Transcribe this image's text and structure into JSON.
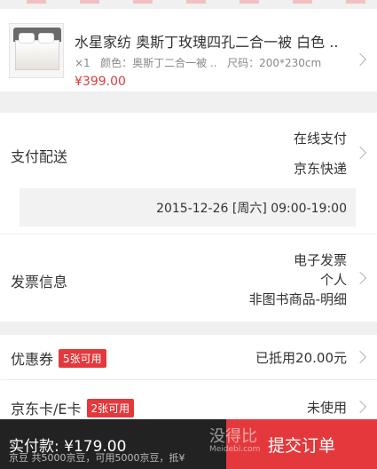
{
  "product": {
    "title": "水星家纺 奥斯丁玫瑰四孔二合一被 白色 ..",
    "qty": "×1",
    "color_label": "颜色：奥斯丁二合一被 ..",
    "size_label": "尺码：200*230cm",
    "price": "¥399.00",
    "image_icon": "product-thumbnail-bedding"
  },
  "payment": {
    "label": "支付配送",
    "method": "在线支付",
    "shipping": "京东快递",
    "delivery_time": "2015-12-26 [周六] 09:00-19:00"
  },
  "invoice": {
    "label": "发票信息",
    "type": "电子发票",
    "title": "个人",
    "content": "非图书商品-明细"
  },
  "coupon": {
    "label": "优惠券",
    "badge": "5张可用",
    "value": "已抵用20.00元"
  },
  "card": {
    "label": "京东卡/E卡",
    "badge": "2张可用",
    "value": "未使用"
  },
  "bottom": {
    "total": "实付款: ¥179.00",
    "submit": "提交订单",
    "jingdou": "京豆 共5000京豆，可用5000京豆，抵¥",
    "watermark_main": "没得比",
    "watermark_sub": "Meidebi.com"
  },
  "colors": {
    "accent": "#e4393c",
    "bar": "#222222",
    "background": "#f0f0f0"
  }
}
